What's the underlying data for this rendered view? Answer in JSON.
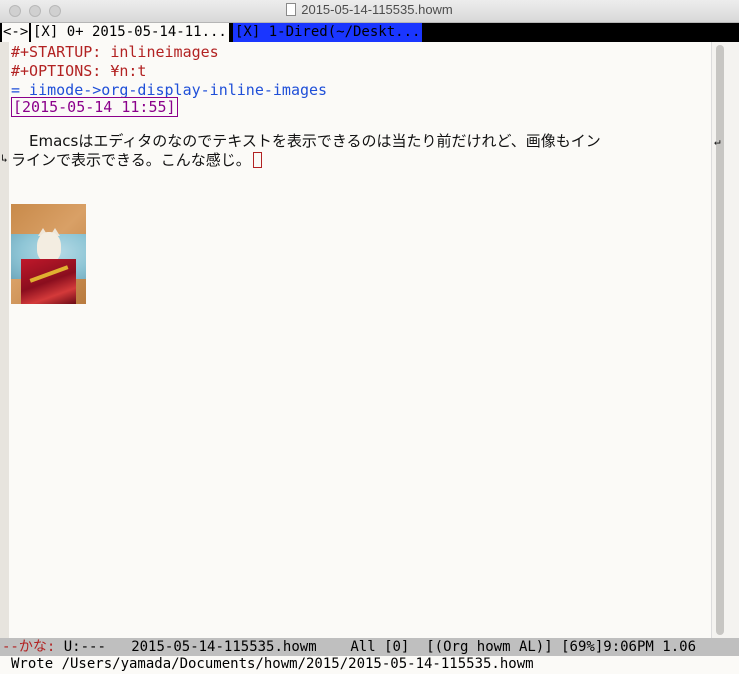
{
  "window": {
    "title": "2015-05-14-115535.howm"
  },
  "tabbar": {
    "nav": "<->",
    "tab1": "[X] 0+ 2015-05-14-11...",
    "tab2": "[X] 1-Dired(~/Deskt..."
  },
  "buffer": {
    "startup": "#+STARTUP: inlineimages",
    "options": "#+OPTIONS: ¥n:t",
    "mode_link": "= iimode->org-display-inline-images",
    "timestamp": "[2015-05-14 11:55]",
    "para_line1": "Emacsはエディタのなのでテキストを表示できるのは当たり前だけれど、画像もイン",
    "para_line2": "ラインで表示できる。こんな感じ。",
    "wrap_right": "↵",
    "wrap_left": "↳"
  },
  "inline_image": {
    "description_icon": "photo-cat-in-box"
  },
  "modeline": {
    "kana": "--かな:",
    "status": "U:---",
    "buffer_name": "2015-05-14-115535.howm",
    "position": "All",
    "line": "[0]",
    "modes": "[(Org howm AL)]",
    "battery": "[69%]",
    "time": "9:06PM",
    "load": "1.06"
  },
  "echo_area": "Wrote /Users/yamada/Documents/howm/2015/2015-05-14-115535.howm",
  "colors": {
    "keyword": "#b22222",
    "link": "#1f4fd8",
    "timestamp": "#8b008b",
    "active_tab": "#1a36ff",
    "modeline_bg": "#bfbfbf"
  }
}
